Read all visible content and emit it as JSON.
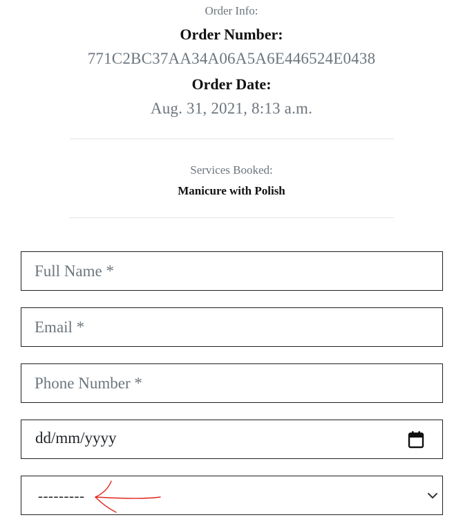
{
  "order": {
    "info_label": "Order Info:",
    "number_label": "Order Number:",
    "number_value": "771C2BC37AA34A06A5A6E446524E0438",
    "date_label": "Order Date:",
    "date_value": "Aug. 31, 2021, 8:13 a.m."
  },
  "services": {
    "label": "Services Booked:",
    "items": [
      "Manicure with Polish"
    ]
  },
  "form": {
    "full_name_placeholder": "Full Name *",
    "email_placeholder": "Email *",
    "phone_placeholder": "Phone Number *",
    "date_placeholder": "dd/mm/yyyy",
    "select_value": "---------"
  },
  "icons": {
    "date": "calendar-icon",
    "select": "chevron-down-icon",
    "annotation": "red-arrow-annotation"
  },
  "colors": {
    "annotation": "#e0241b",
    "muted_text": "#6c757d",
    "border": "#1f1f1f"
  }
}
